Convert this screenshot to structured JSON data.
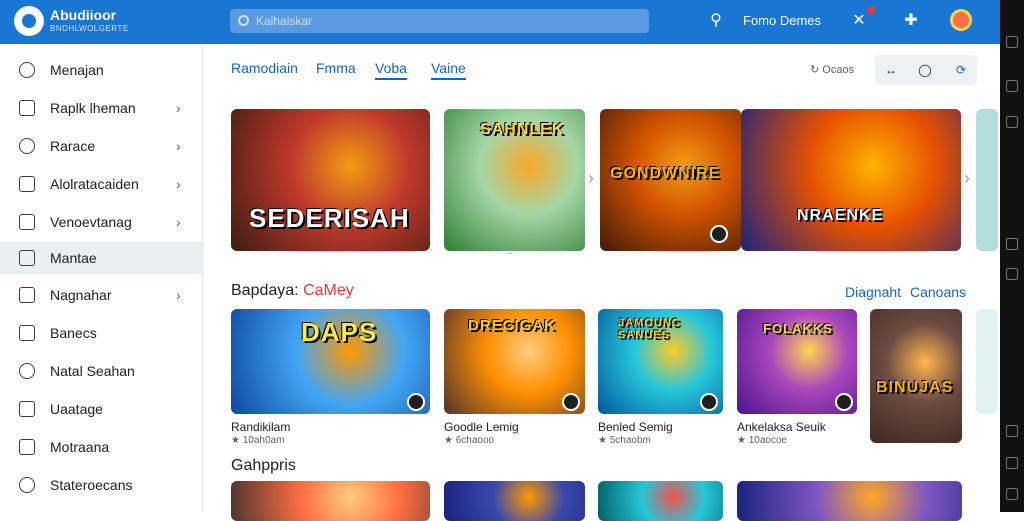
{
  "header": {
    "brand": "Abudiioor",
    "brand_sub": "BNDHLWOLGERTE",
    "search_placeholder": "Kalhaiskar",
    "account_label": "Fomo Demes",
    "icons": [
      "search-icon",
      "notification-icon",
      "add-icon",
      "avatar"
    ]
  },
  "sidebar": {
    "items": [
      {
        "label": "Menajan",
        "icon": "search-icon",
        "chevron": false,
        "active": false
      },
      {
        "label": "Raplk lheman",
        "icon": "heart-icon",
        "chevron": true,
        "active": false
      },
      {
        "label": "Rarace",
        "icon": "phone-icon",
        "chevron": true,
        "active": false
      },
      {
        "label": "Alolratacaiden",
        "icon": "chart-icon",
        "chevron": true,
        "active": false
      },
      {
        "label": "Venoevtanag",
        "icon": "document-icon",
        "chevron": true,
        "active": false
      },
      {
        "label": "Mantae",
        "icon": "window-icon",
        "chevron": false,
        "active": true
      },
      {
        "label": "Nagnahar",
        "icon": "image-icon",
        "chevron": true,
        "active": false
      },
      {
        "label": "Banecs",
        "icon": "folder-icon",
        "chevron": false,
        "active": false
      },
      {
        "label": "Natal Seahan",
        "icon": "clock-icon",
        "chevron": false,
        "active": false
      },
      {
        "label": "Uaatage",
        "icon": "list-icon",
        "chevron": false,
        "active": false
      },
      {
        "label": "Motraana",
        "icon": "lock-icon",
        "chevron": false,
        "active": false
      },
      {
        "label": "Stateroecans",
        "icon": "settings-icon",
        "chevron": false,
        "active": false
      }
    ]
  },
  "main": {
    "tabs": [
      {
        "label": "Ramodiain",
        "underline": false
      },
      {
        "label": "Fmma",
        "underline": false
      },
      {
        "label": "Voba",
        "underline": true
      },
      {
        "label": "Vaine",
        "underline": true
      }
    ],
    "toolbar_label": "↻ Ocaos",
    "featured": [
      {
        "title": "SEDERISAH",
        "colors": [
          "#3b1d12",
          "#c0392b",
          "#f39c12"
        ]
      },
      {
        "title": "SAHNLEK",
        "colors": [
          "#2e7d32",
          "#a5d6a7",
          "#f9a825"
        ]
      },
      {
        "title": "GONDWNIRE",
        "colors": [
          "#3e1a0a",
          "#d35400",
          "#f39c12"
        ]
      },
      {
        "title": "NRAENKE",
        "colors": [
          "#1a237e",
          "#e65100",
          "#ffb300"
        ]
      }
    ],
    "section1": {
      "title": "Bapdaya:",
      "accent": "CaMey",
      "links": [
        "Diagnaht",
        "Canoans"
      ],
      "games": [
        {
          "art": "DAPS",
          "name": "Randikilam",
          "meta": "★ 10ah0am",
          "colors": [
            "#0d47a1",
            "#42a5f5",
            "#ff9800"
          ]
        },
        {
          "art": "DRECIGAK",
          "name": "Goodle Lemig",
          "meta": "★ 6chaooo",
          "colors": [
            "#4e342e",
            "#ff8f00",
            "#ffcc80"
          ]
        },
        {
          "art": "JAMOUNC SANUES",
          "name": "Benled Semig",
          "meta": "★ 5chaobm",
          "colors": [
            "#01579b",
            "#26c6da",
            "#ffca28"
          ]
        },
        {
          "art": "FOLAKKS",
          "name": "Ankelaksa Seuik",
          "meta": "★ 10aocoe",
          "colors": [
            "#4a148c",
            "#ab47bc",
            "#ffd54f"
          ]
        },
        {
          "art": "BINUJAS",
          "name": "",
          "meta": "",
          "colors": [
            "#3e2723",
            "#6d4c41",
            "#ffb74d"
          ]
        }
      ]
    },
    "section2": {
      "title": "Gahppris",
      "games": [
        {
          "colors": [
            "#4e342e",
            "#ff7043",
            "#ffcc80"
          ]
        },
        {
          "colors": [
            "#1a237e",
            "#3949ab",
            "#ff9800"
          ]
        },
        {
          "colors": [
            "#006064",
            "#26c6da",
            "#ef5350"
          ]
        },
        {
          "colors": [
            "#1a237e",
            "#7e57c2",
            "#ffa726"
          ]
        }
      ]
    }
  }
}
